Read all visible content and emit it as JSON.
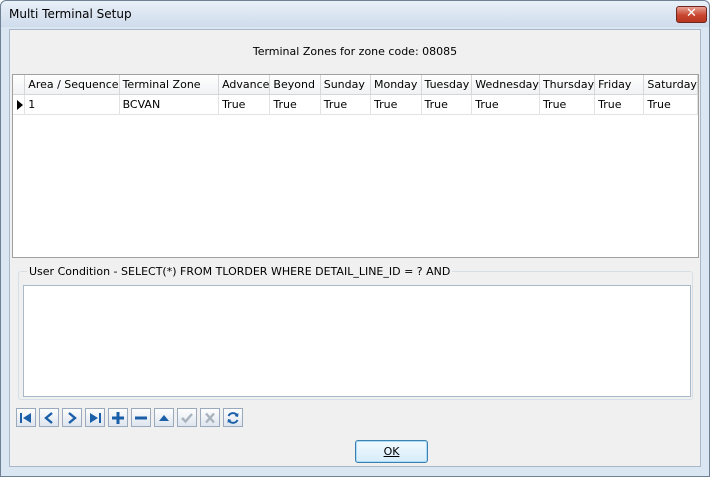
{
  "window": {
    "title": "Multi Terminal Setup",
    "close_icon": "close-x-icon"
  },
  "header": {
    "zone_text": "Terminal Zones for zone code: 08085"
  },
  "grid": {
    "columns": [
      "Area / Sequence",
      "Terminal Zone",
      "Advance",
      "Beyond",
      "Sunday",
      "Monday",
      "Tuesday",
      "Wednesday",
      "Thursday",
      "Friday",
      "Saturday"
    ],
    "rows": [
      {
        "current": true,
        "cells": [
          "1",
          "BCVAN",
          "True",
          "True",
          "True",
          "True",
          "True",
          "True",
          "True",
          "True",
          "True"
        ]
      }
    ]
  },
  "condition": {
    "label": "User Condition - SELECT(*) FROM TLORDER WHERE DETAIL_LINE_ID = ? AND",
    "value": ""
  },
  "navigator": {
    "buttons": [
      {
        "name": "first-record-button",
        "icon": "first-icon",
        "enabled": true
      },
      {
        "name": "prior-record-button",
        "icon": "prior-icon",
        "enabled": true
      },
      {
        "name": "next-record-button",
        "icon": "next-icon",
        "enabled": true
      },
      {
        "name": "last-record-button",
        "icon": "last-icon",
        "enabled": true
      },
      {
        "name": "insert-record-button",
        "icon": "plus-icon",
        "enabled": true
      },
      {
        "name": "delete-record-button",
        "icon": "minus-icon",
        "enabled": true
      },
      {
        "name": "edit-record-button",
        "icon": "up-triangle-icon",
        "enabled": true
      },
      {
        "name": "post-record-button",
        "icon": "check-icon",
        "enabled": false
      },
      {
        "name": "cancel-record-button",
        "icon": "x-icon",
        "enabled": false
      },
      {
        "name": "refresh-button",
        "icon": "refresh-icon",
        "enabled": true
      }
    ]
  },
  "footer": {
    "ok_label": "OK"
  },
  "colors": {
    "nav_icon": "#1a5fa8",
    "disabled_icon": "#a9b3bd",
    "close_button": "#c8452f"
  }
}
